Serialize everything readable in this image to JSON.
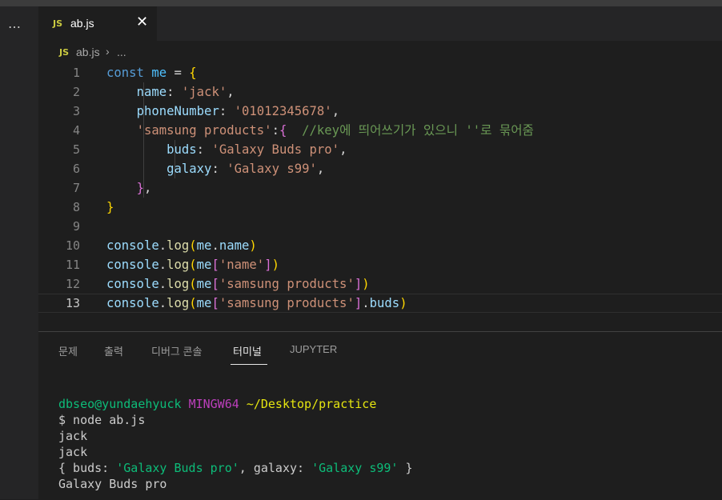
{
  "sidebar": {
    "more_icon": "…"
  },
  "tab": {
    "icon_label": "JS",
    "filename": "ab.js",
    "close_glyph": "✕"
  },
  "breadcrumb": {
    "icon_label": "JS",
    "file": "ab.js",
    "separator": "›",
    "more": "..."
  },
  "editor": {
    "line_numbers": [
      "1",
      "2",
      "3",
      "4",
      "5",
      "6",
      "7",
      "8",
      "9",
      "10",
      "11",
      "12",
      "13"
    ],
    "current_line": 13,
    "lines": [
      [
        {
          "t": "const",
          "c": "kw"
        },
        {
          "t": " "
        },
        {
          "t": "me",
          "c": "var"
        },
        {
          "t": " = "
        },
        {
          "t": "{",
          "c": "b1"
        }
      ],
      [
        {
          "t": "    "
        },
        {
          "t": "name",
          "c": "prop"
        },
        {
          "t": ": "
        },
        {
          "t": "'jack'",
          "c": "str"
        },
        {
          "t": ","
        }
      ],
      [
        {
          "t": "    "
        },
        {
          "t": "phoneNumber",
          "c": "prop"
        },
        {
          "t": ": "
        },
        {
          "t": "'01012345678'",
          "c": "str"
        },
        {
          "t": ","
        }
      ],
      [
        {
          "t": "    "
        },
        {
          "t": "'samsung products'",
          "c": "str"
        },
        {
          "t": ":"
        },
        {
          "t": "{",
          "c": "b2"
        },
        {
          "t": "  "
        },
        {
          "t": "//key에 띄어쓰기가 있으니 ''로 묶어줌",
          "c": "cmt"
        }
      ],
      [
        {
          "t": "        "
        },
        {
          "t": "buds",
          "c": "prop"
        },
        {
          "t": ": "
        },
        {
          "t": "'Galaxy Buds pro'",
          "c": "str"
        },
        {
          "t": ","
        }
      ],
      [
        {
          "t": "        "
        },
        {
          "t": "galaxy",
          "c": "prop"
        },
        {
          "t": ": "
        },
        {
          "t": "'Galaxy s99'",
          "c": "str"
        },
        {
          "t": ","
        }
      ],
      [
        {
          "t": "    "
        },
        {
          "t": "}",
          "c": "b2"
        },
        {
          "t": ","
        }
      ],
      [
        {
          "t": "}",
          "c": "b1"
        }
      ],
      [],
      [
        {
          "t": "console",
          "c": "prop"
        },
        {
          "t": "."
        },
        {
          "t": "log",
          "c": "fn"
        },
        {
          "t": "(",
          "c": "b1"
        },
        {
          "t": "me",
          "c": "prop"
        },
        {
          "t": "."
        },
        {
          "t": "name",
          "c": "prop"
        },
        {
          "t": ")",
          "c": "b1"
        }
      ],
      [
        {
          "t": "console",
          "c": "prop"
        },
        {
          "t": "."
        },
        {
          "t": "log",
          "c": "fn"
        },
        {
          "t": "(",
          "c": "b1"
        },
        {
          "t": "me",
          "c": "prop"
        },
        {
          "t": "[",
          "c": "b2"
        },
        {
          "t": "'name'",
          "c": "str"
        },
        {
          "t": "]",
          "c": "b2"
        },
        {
          "t": ")",
          "c": "b1"
        }
      ],
      [
        {
          "t": "console",
          "c": "prop"
        },
        {
          "t": "."
        },
        {
          "t": "log",
          "c": "fn"
        },
        {
          "t": "(",
          "c": "b1"
        },
        {
          "t": "me",
          "c": "prop"
        },
        {
          "t": "[",
          "c": "b2"
        },
        {
          "t": "'samsung products'",
          "c": "str"
        },
        {
          "t": "]",
          "c": "b2"
        },
        {
          "t": ")",
          "c": "b1"
        }
      ],
      [
        {
          "t": "console",
          "c": "prop"
        },
        {
          "t": "."
        },
        {
          "t": "log",
          "c": "fn"
        },
        {
          "t": "(",
          "c": "b1"
        },
        {
          "t": "me",
          "c": "prop"
        },
        {
          "t": "[",
          "c": "b2"
        },
        {
          "t": "'samsung products'",
          "c": "str"
        },
        {
          "t": "]",
          "c": "b2"
        },
        {
          "t": "."
        },
        {
          "t": "buds",
          "c": "prop"
        },
        {
          "t": ")",
          "c": "b1"
        }
      ]
    ]
  },
  "panel": {
    "tabs": [
      {
        "label": "문제",
        "active": false
      },
      {
        "label": "출력",
        "active": false
      },
      {
        "label": "디버그 콘솔",
        "active": false
      },
      {
        "label": "터미널",
        "active": true
      },
      {
        "label": "JUPYTER",
        "active": false
      }
    ]
  },
  "terminal": {
    "prompt_user": "dbseo@yundaehyuck",
    "prompt_env": "MINGW64",
    "prompt_path": "~/Desktop/practice",
    "command": "$ node ab.js",
    "output": [
      [
        {
          "t": "jack"
        }
      ],
      [
        {
          "t": "jack"
        }
      ],
      [
        {
          "t": "{ buds: "
        },
        {
          "t": "'Galaxy Buds pro'",
          "c": "green"
        },
        {
          "t": ", galaxy: "
        },
        {
          "t": "'Galaxy s99'",
          "c": "green"
        },
        {
          "t": " }"
        }
      ],
      [
        {
          "t": "Galaxy Buds pro"
        }
      ]
    ]
  },
  "colors": {
    "editor_bg": "#1e1e1e",
    "keyword": "#569cd6",
    "string": "#ce9178",
    "comment": "#6a9955",
    "terminal_green": "#0dbc79",
    "terminal_magenta": "#bc3fbc",
    "terminal_yellow": "#e5e510"
  }
}
